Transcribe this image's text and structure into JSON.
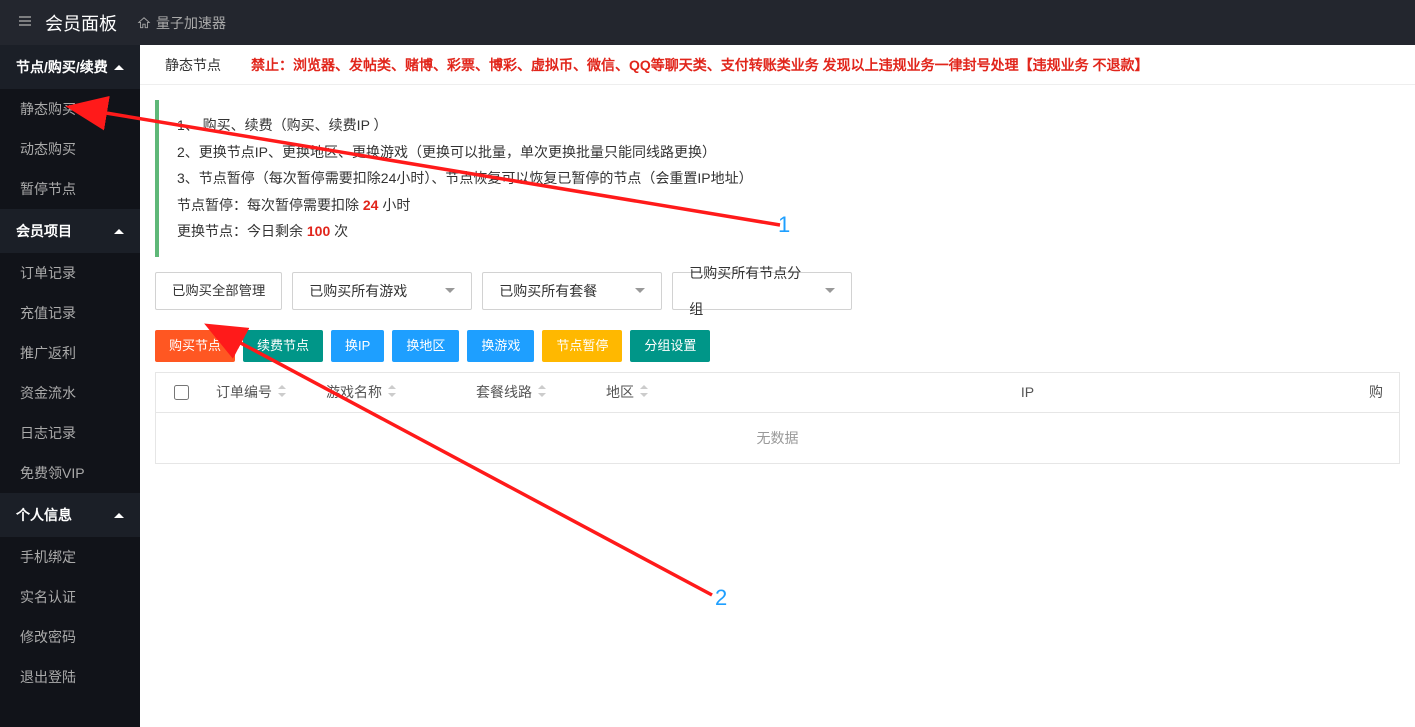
{
  "header": {
    "title": "会员面板",
    "home_label": "量子加速器"
  },
  "sidebar": {
    "group1": {
      "title": "节点/购买/续费",
      "items": [
        "静态购买",
        "动态购买",
        "暂停节点"
      ]
    },
    "group2": {
      "title": "会员项目",
      "items": [
        "订单记录",
        "充值记录",
        "推广返利",
        "资金流水",
        "日志记录",
        "免费领VIP"
      ]
    },
    "group3": {
      "title": "个人信息",
      "items": [
        "手机绑定",
        "实名认证",
        "修改密码",
        "退出登陆"
      ]
    }
  },
  "tab": {
    "label": "静态节点"
  },
  "warning_bar": "禁止：浏览器、发帖类、赌博、彩票、博彩、虚拟币、微信、QQ等聊天类、支付转账类业务 发现以上违规业务一律封号处理【违规业务 不退款】",
  "notice": {
    "l1": "1、 购买、续费（购买、续费IP ）",
    "l2": "2、更换节点IP、更换地区、更换游戏（更换可以批量，单次更换批量只能同线路更换）",
    "l3": "3、节点暂停（每次暂停需要扣除24小时）、节点恢复可以恢复已暂停的节点（会重置IP地址）",
    "l4a": "节点暂停：每次暂停需要扣除 ",
    "l4n": "24",
    "l4b": " 小时",
    "l5a": "更换节点：今日剩余 ",
    "l5n": "100",
    "l5b": " 次"
  },
  "filters": {
    "all_btn": "已购买全部管理",
    "game": "已购买所有游戏",
    "plan": "已购买所有套餐",
    "group": "已购买所有节点分组"
  },
  "actions": {
    "buy": "购买节点",
    "renew": "续费节点",
    "chip": "换IP",
    "chregion": "换地区",
    "chgame": "换游戏",
    "pause": "节点暂停",
    "grpset": "分组设置"
  },
  "columns": {
    "c1": "订单编号",
    "c2": "游戏名称",
    "c3": "套餐线路",
    "c4": "地区",
    "c5": "IP",
    "c6": "购"
  },
  "table": {
    "empty": "无数据"
  },
  "annot": {
    "n1": "1",
    "n2": "2"
  }
}
